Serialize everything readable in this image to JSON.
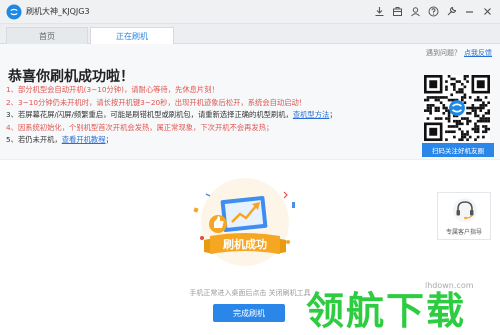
{
  "window": {
    "title": "刷机大神_KJQJG3"
  },
  "tabs": [
    {
      "label": "首页"
    },
    {
      "label": "正在刷机"
    }
  ],
  "help": {
    "prompt": "遇到问题？",
    "link": "点我反馈"
  },
  "success": {
    "heading": "恭喜你刷机成功啦！",
    "steps": [
      {
        "text": "1、部分机型会自动开机(3~10分钟)，请耐心等待，先休息片刻！"
      },
      {
        "text": "2、3~10分钟仍未开机时，请长按开机键3~20秒，出现开机迹象后松开，系统会自动启动！"
      },
      {
        "text": "3、若屏幕花屏/闪屏/频繁重启，可能是刷错机型或刷机包，请重新选择正确的机型刷机，",
        "link": "查机型方法",
        "suffix": "；"
      },
      {
        "text": "4、因系统初始化，个别机型首次开机会发热，属正常现象，下次开机不会再发热；"
      },
      {
        "text": "5、若仍未开机，",
        "link": "查看开机教程",
        "suffix": "；"
      }
    ]
  },
  "qr": {
    "button": "扫码关注好机友圈"
  },
  "illustration": {
    "badge": "刷机成功"
  },
  "footer": {
    "hint": "手机正常进入桌面后点击 关闭刷机工具",
    "done_button": "完成刷机"
  },
  "support": {
    "label": "专属客户指导"
  },
  "watermark": {
    "url": "lhdown.com",
    "logo_text": "领航下载"
  },
  "colors": {
    "accent": "#2a86e8",
    "warning_text": "#e0554f",
    "link": "#2a6fd6"
  }
}
